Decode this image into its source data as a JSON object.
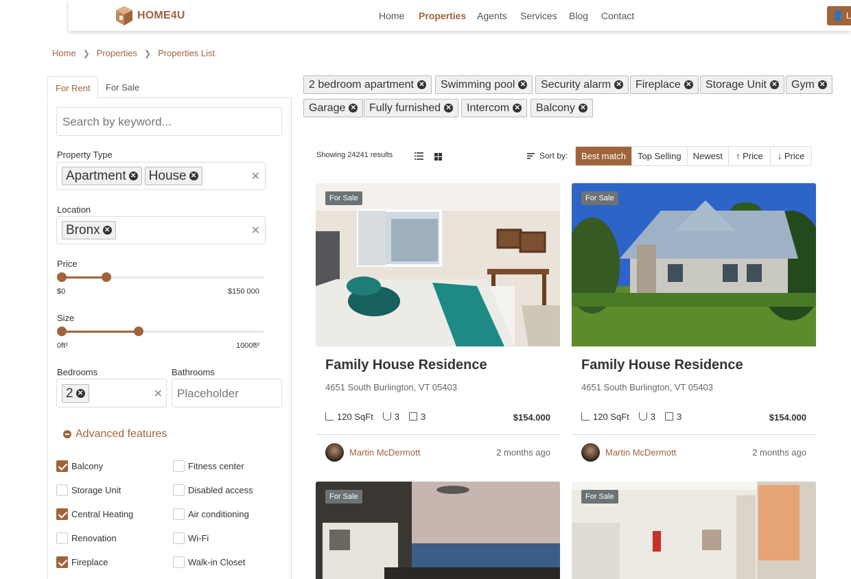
{
  "brand": {
    "name": "HOME4U"
  },
  "nav": {
    "items": [
      "Home",
      "Properties",
      "Agents",
      "Services",
      "Blog",
      "Contact"
    ],
    "active": "Properties",
    "login_label": "Lo"
  },
  "breadcrumb": [
    "Home",
    "Properties",
    "Properties List"
  ],
  "filters": {
    "tabs": [
      "For Rent",
      "For Sale"
    ],
    "search_placeholder": "Search by keyword...",
    "property_type": {
      "label": "Property Type",
      "chips": [
        "Apartment",
        "House"
      ]
    },
    "location": {
      "label": "Location",
      "chips": [
        "Bronx"
      ]
    },
    "price": {
      "label": "Price",
      "min_label": "$0",
      "max_label": "$150 000",
      "low": 0,
      "high": 0.22
    },
    "size": {
      "label": "Size",
      "min_label": "0ft²",
      "max_label": "1000ft²",
      "low": 0,
      "high": 0.38
    },
    "bedrooms": {
      "label": "Bedrooms",
      "chips": [
        "2"
      ]
    },
    "bathrooms": {
      "label": "Bathrooms",
      "placeholder": "Placeholder"
    },
    "advanced_label": "Advanced features",
    "features": [
      {
        "label": "Balcony",
        "checked": true
      },
      {
        "label": "Fitness center",
        "checked": false
      },
      {
        "label": "Storage Unit",
        "checked": false
      },
      {
        "label": "Disabled access",
        "checked": false
      },
      {
        "label": "Central Heating",
        "checked": true
      },
      {
        "label": "Air conditioning",
        "checked": false
      },
      {
        "label": "Renovation",
        "checked": false
      },
      {
        "label": "Wi-Fi",
        "checked": false
      },
      {
        "label": "Fireplace",
        "checked": true
      },
      {
        "label": "Walk-in Closet",
        "checked": false
      }
    ]
  },
  "active_tags": [
    "2 bedroom apartment",
    "Swimming pool",
    "Security alarm",
    "Fireplace",
    "Storage Unit",
    "Gym",
    "Garage",
    "Fully furnished",
    "Intercom",
    "Balcony"
  ],
  "results": {
    "showing_text": "Showing 24241 results",
    "sort_label": "Sort by:",
    "sort_options": [
      "Best match",
      "Top Selling",
      "Newest",
      "↑ Price",
      "↓ Price"
    ],
    "active_sort": "Best match"
  },
  "cards": [
    {
      "badge": "For Sale",
      "title": "Family House Residence",
      "address": "4651 South Burlington, VT 05403",
      "area": "120 SqFt",
      "baths": "3",
      "beds": "3",
      "price": "$154.000",
      "agent": "Martin McDermott",
      "date": "2 months ago",
      "image": "bedroom"
    },
    {
      "badge": "For Sale",
      "title": "Family House Residence",
      "address": "4651 South Burlington, VT 05403",
      "area": "120 SqFt",
      "baths": "3",
      "beds": "3",
      "price": "$154.000",
      "agent": "Martin McDermott",
      "date": "2 months ago",
      "image": "house"
    },
    {
      "badge": "For Sale",
      "image": "dining-sea"
    },
    {
      "badge": "For Sale",
      "image": "living-room"
    }
  ],
  "colors": {
    "accent": "#a0643b",
    "badge": "#6b7375"
  }
}
